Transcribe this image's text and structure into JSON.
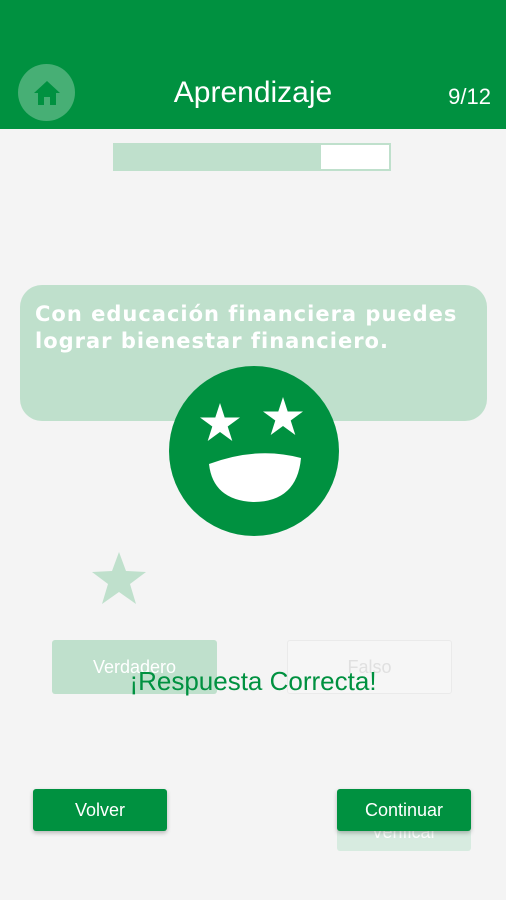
{
  "header": {
    "title": "Aprendizaje",
    "counter": "9/12",
    "home_icon": "home-icon"
  },
  "progress": {
    "value": 9,
    "total": 12
  },
  "question": {
    "text": "Con educación financiera puedes lograr bienestar financiero."
  },
  "answers": {
    "true_label": "Verdadero",
    "false_label": "Falso"
  },
  "feedback": {
    "message": "¡Respuesta Correcta!",
    "icon": "star-eyes-smiley-icon"
  },
  "footer": {
    "back_label": "Volver",
    "continue_label": "Continuar",
    "verify_label": "Verificar"
  },
  "colors": {
    "brand_green": "#009140",
    "light_green": "#bfe0cc",
    "background": "#f4f4f4"
  }
}
